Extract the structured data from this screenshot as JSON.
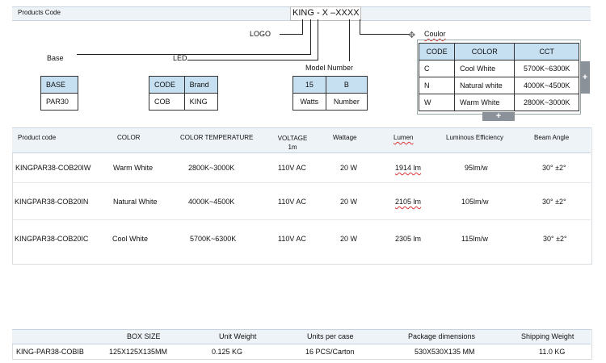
{
  "top_bar": {
    "label": "Products Code",
    "code_pattern": "KING - X –XXXX"
  },
  "diagram": {
    "logo": "LOGO",
    "base": "Base",
    "led": "LED",
    "model_number": "Model Number",
    "coulor": "Coulor",
    "base_table": {
      "header": "BASE",
      "value": "PAR30"
    },
    "led_table": {
      "headers": [
        "CODE",
        "Brand"
      ],
      "values": [
        "COB",
        "KING"
      ]
    },
    "model_table": {
      "row1": [
        "15",
        "B"
      ],
      "row2": [
        "Watts",
        "Number"
      ]
    },
    "color_table": {
      "headers": [
        "CODE",
        "COLOR",
        "CCT"
      ],
      "rows": [
        [
          "C",
          "Cool White",
          "5700K~6300K"
        ],
        [
          "N",
          "Natural white",
          "4000K~4500K"
        ],
        [
          "W",
          "Warm White",
          "2800K~3000K"
        ]
      ]
    }
  },
  "spec_table": {
    "headers": [
      "Product code",
      "COLOR",
      "COLOR TEMPERATURE",
      "VOLTAGE",
      "1m",
      "Wattage",
      "Lumen",
      "Luminous Efficiency",
      "Beam Angle"
    ],
    "rows": [
      [
        "KINGPAR38-COB20IW",
        "Warm White",
        "2800K~3000K",
        "110V AC",
        "20 W",
        "1914 lm",
        "95lm/w",
        "30° ±2°"
      ],
      [
        "KINGPAR38-COB20IN",
        "Natural White",
        "4000K~4500K",
        "110V AC",
        "20 W",
        "2105 lm",
        "105lm/w",
        "30° ±2°"
      ],
      [
        "KINGPAR38-COB20IC",
        "Cool White",
        "5700K~6300K",
        "110V AC",
        "20 W",
        "2305 lm",
        "115lm/w",
        "30° ±2°"
      ]
    ]
  },
  "package_table": {
    "headers": [
      "BOX SIZE",
      "Unit Weight",
      "Units per case",
      "Package dimensions",
      "Shipping Weight"
    ],
    "row": [
      "KING-PAR38-COBIB",
      "125X125X135MM",
      "0.125 KG",
      "16 PCS/Carton",
      "530X530X135 MM",
      "11.0 KG"
    ]
  },
  "colors": {
    "header_bar": "#eef3f8",
    "cell_header": "#c6e0f1",
    "spell_mark": "#d33"
  }
}
